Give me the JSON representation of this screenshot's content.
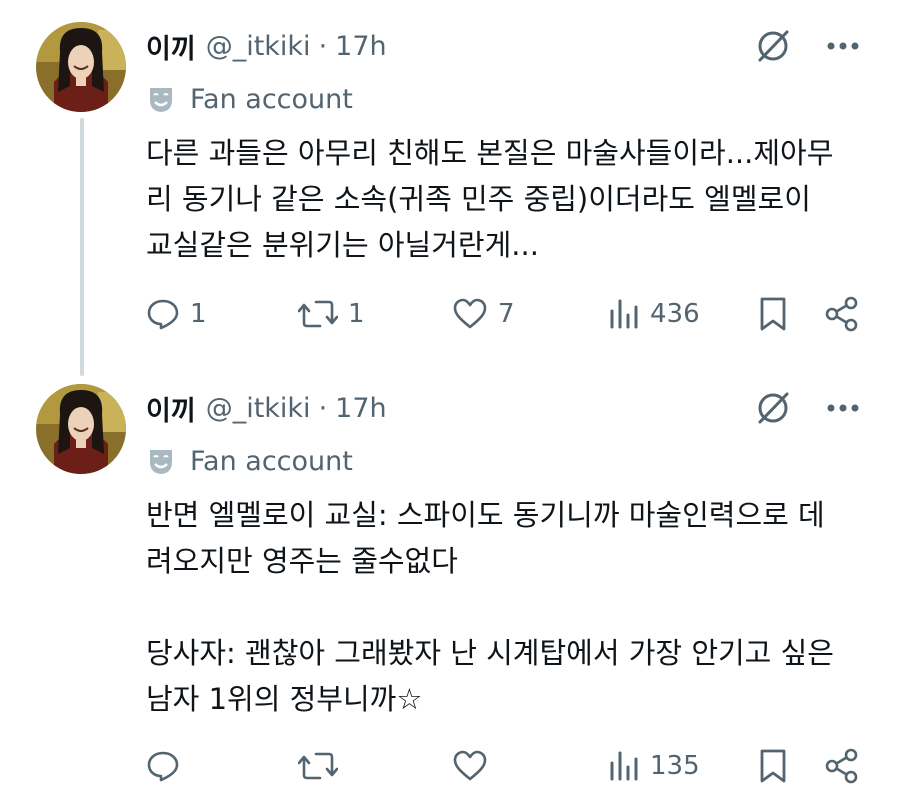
{
  "tweets": [
    {
      "display_name": "이끼",
      "handle": "@_itkiki",
      "separator": "·",
      "time": "17h",
      "badge_label": "Fan account",
      "text": "다른 과들은 아무리 친해도 본질은 마술사들이라...제아무\n리 동기나 같은 소속(귀족 민주 중립)이더라도 엘멜로이\n교실같은 분위기는 아닐거란게...",
      "replies": "1",
      "reposts": "1",
      "likes": "7",
      "views": "436"
    },
    {
      "display_name": "이끼",
      "handle": "@_itkiki",
      "separator": "·",
      "time": "17h",
      "badge_label": "Fan account",
      "text": "반면 엘멜로이 교실: 스파이도 동기니까 마술인력으로 데\n려오지만 영주는 줄수없다\n\n당사자: 괜찮아 그래봤자 난 시계탑에서 가장 안기고 싶은\n남자 1위의 정부니까☆",
      "replies": "",
      "reposts": "",
      "likes": "",
      "views": "135"
    }
  ],
  "icons": {
    "grok": "grok-slash-icon",
    "more": "more-dots-icon",
    "badge": "theater-mask-icon",
    "reply": "reply-bubble-icon",
    "repost": "repost-arrows-icon",
    "like": "heart-icon",
    "views": "views-bars-icon",
    "bookmark": "bookmark-icon",
    "share": "share-icon"
  },
  "colors": {
    "text": "#0f1419",
    "secondary": "#536471",
    "thread_line": "#cfd9de"
  }
}
